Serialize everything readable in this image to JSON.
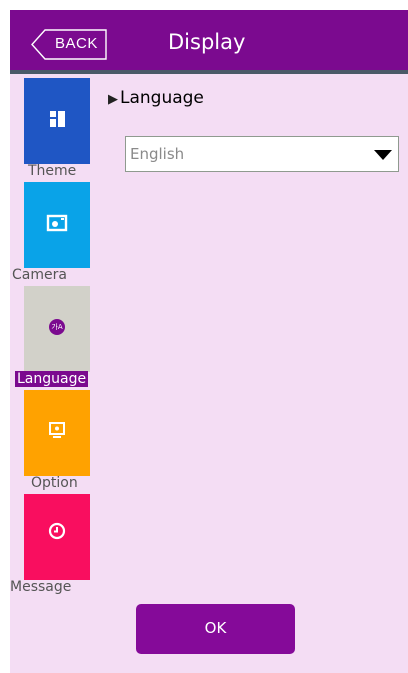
{
  "header": {
    "back_label": "BACK",
    "title": "Display"
  },
  "sidebar": {
    "items": [
      {
        "label": "Theme",
        "color": "#1f56c4",
        "icon": "theme-icon"
      },
      {
        "label": "Camera",
        "color": "#09a3e8",
        "icon": "camera-icon"
      },
      {
        "label": "Language",
        "color": "#d2d1c9",
        "icon": "language-icon",
        "active": true
      },
      {
        "label": "Option",
        "color": "#ffa200",
        "icon": "monitor-icon"
      },
      {
        "label": "Message",
        "color": "#f90e5f",
        "icon": "clock-icon"
      }
    ]
  },
  "main": {
    "section_title": "Language",
    "language_select": {
      "value": "English"
    },
    "ok_label": "OK"
  },
  "colors": {
    "header": "#7b0a8f",
    "background": "#f4ddf4",
    "accent": "#850a99"
  }
}
